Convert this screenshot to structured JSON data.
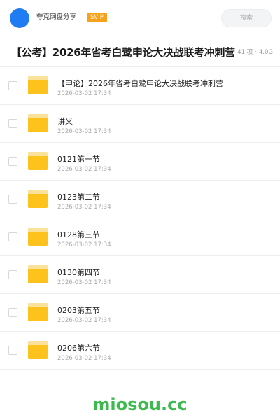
{
  "header": {
    "user_name": "夸克网盘分享",
    "badge": "SVIP",
    "search_placeholder": "搜索"
  },
  "folder": {
    "title": "【公考】2026年省考白鹭申论大决战联考冲刺营",
    "item_count": "41 项",
    "separator": "·",
    "size": "4.0G"
  },
  "items": [
    {
      "name": "【申论】2026年省考白鹭申论大决战联考冲刺营",
      "date": "2026-03-02 17:34"
    },
    {
      "name": "讲义",
      "date": "2026-03-02 17:34"
    },
    {
      "name": "0121第一节",
      "date": "2026-03-02 17:34"
    },
    {
      "name": "0123第二节",
      "date": "2026-03-02 17:34"
    },
    {
      "name": "0128第三节",
      "date": "2026-03-02 17:34"
    },
    {
      "name": "0130第四节",
      "date": "2026-03-02 17:34"
    },
    {
      "name": "0203第五节",
      "date": "2026-03-02 17:34"
    },
    {
      "name": "0206第六节",
      "date": "2026-03-02 17:34"
    }
  ],
  "watermark": "miosou.cc",
  "colors": {
    "avatar": "#1f7cf2",
    "badge": "#f7a21b",
    "folder_icon": "#fdc21b",
    "watermark": "#3dba4e"
  }
}
